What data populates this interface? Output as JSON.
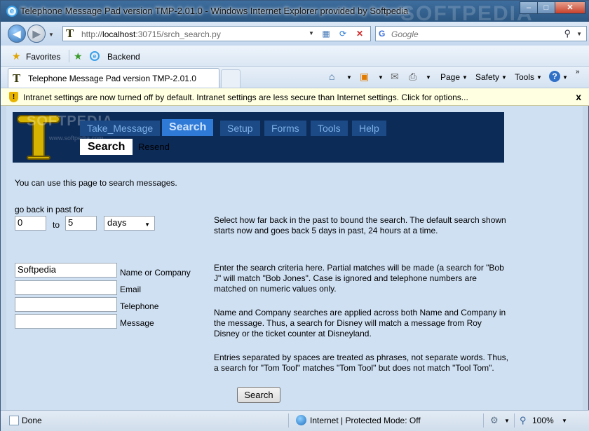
{
  "window": {
    "title": "Telephone Message Pad version TMP-2.01.0 - Windows Internet Explorer provided by Softpedia",
    "watermark": "SOFTPEDIA",
    "minimize": "–",
    "maximize": "□",
    "close": "✕"
  },
  "nav": {
    "url_prefix": "http://",
    "url_host": "localhost",
    "url_rest": ":30715/srch_search.py",
    "search_placeholder": "Google"
  },
  "favorites": {
    "label": "Favorites",
    "link": "Backend"
  },
  "tab": {
    "label": "Telephone Message Pad version TMP-2.01.0"
  },
  "commands": {
    "page": "Page",
    "safety": "Safety",
    "tools": "Tools",
    "help": "?"
  },
  "infobar": {
    "message": "Intranet settings are now turned off by default. Intranet settings are less secure than Internet settings. Click for options...",
    "close": "x"
  },
  "app": {
    "banner_watermark": "SOFTPEDIA",
    "banner_watermark_sub": "www.softpedia.com",
    "menu": [
      "Take_Message",
      "Search",
      "Setup",
      "Forms",
      "Tools",
      "Help"
    ],
    "active_menu": "Search",
    "submenu": [
      "Search",
      "Resend"
    ]
  },
  "page": {
    "intro": "You can use this page to search messages.",
    "goback_label": "go back in past for",
    "from_value": "0",
    "to_label": "to",
    "to_value": "5",
    "unit_selected": "days",
    "range_help": "Select how far back in the past to bound the search. The default search shown starts now and goes back 5 days in past, 24 hours at a time.",
    "fields": [
      {
        "label": "Name or Company",
        "value": "Softpedia"
      },
      {
        "label": "Email",
        "value": ""
      },
      {
        "label": "Telephone",
        "value": ""
      },
      {
        "label": "Message",
        "value": ""
      }
    ],
    "help1": "Enter the search criteria here. Partial matches will be made (a search for \"Bob J\" will match \"Bob Jones\". Case is ignored and telephone numbers are matched on numeric values only.",
    "help2": "Name and Company searches are applied across both Name and Company in the message. Thus, a search for Disney will match a message from Roy Disney or the ticket counter at Disneyland.",
    "help3": "Entries separated by spaces are treated as phrases, not separate words. Thus, a search for \"Tom Tool\" matches \"Tom Tool\" but does not match \"Tool Tom\".",
    "search_button": "Search"
  },
  "status": {
    "left": "Done",
    "zone": "Internet | Protected Mode: Off",
    "zoom": "100%"
  }
}
